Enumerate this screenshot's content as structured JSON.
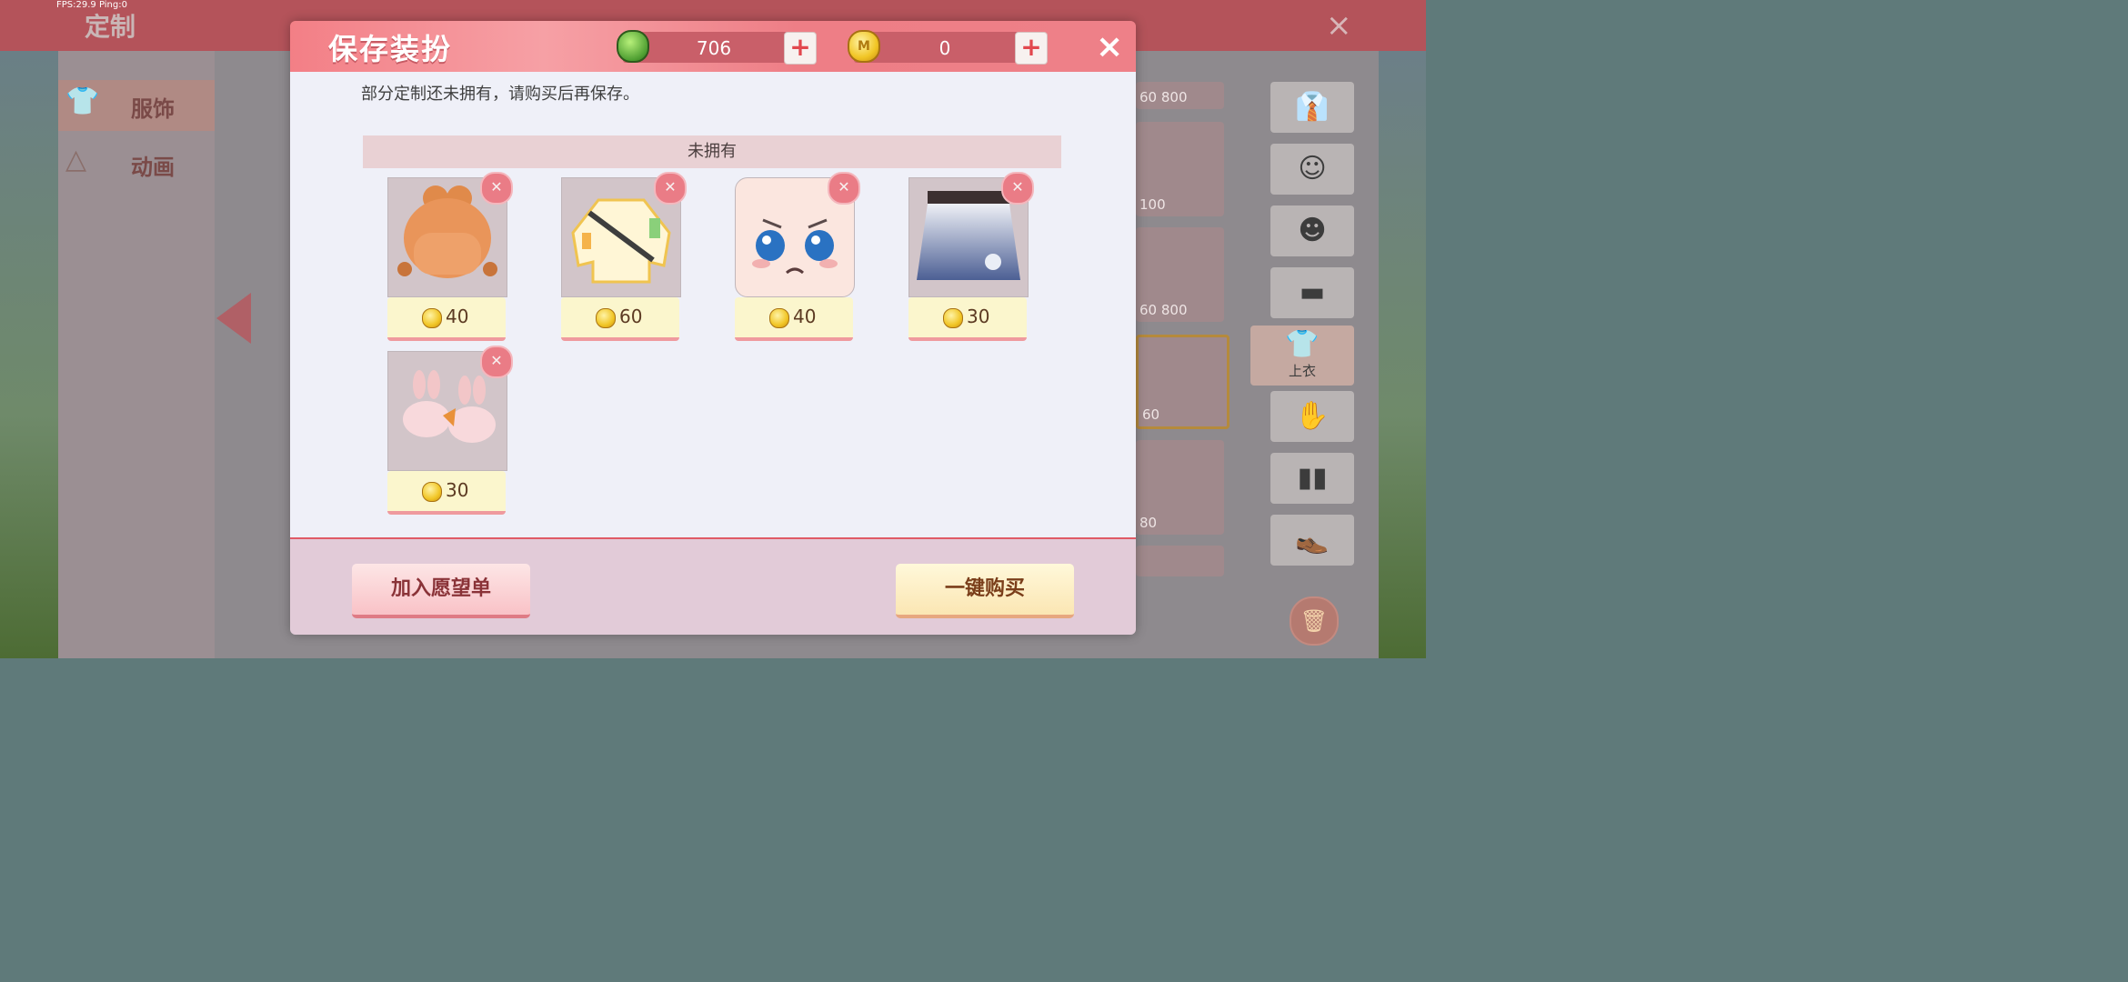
{
  "status": {
    "fps": "FPS:29.9  Ping:0"
  },
  "page": {
    "title": "定制",
    "close": "×"
  },
  "leftnav": {
    "items": [
      {
        "label": "服饰",
        "active": true
      },
      {
        "label": "动画",
        "active": false
      }
    ]
  },
  "right_cards": {
    "prices": [
      "60",
      "800",
      "100",
      "60",
      "800",
      "60",
      "80"
    ]
  },
  "right_tabs": {
    "selected_label": "上衣"
  },
  "dialog": {
    "title": "保存装扮",
    "currency": {
      "gem": "706",
      "coin": "0"
    },
    "plus": "+",
    "close": "×",
    "message": "部分定制还未拥有，请购买后再保存。",
    "section_title": "未拥有",
    "items": [
      {
        "name": "hair",
        "price": "40"
      },
      {
        "name": "jacket",
        "price": "60"
      },
      {
        "name": "face",
        "price": "40"
      },
      {
        "name": "skirt",
        "price": "30"
      },
      {
        "name": "slippers",
        "price": "30"
      }
    ],
    "wishlist_button": "加入愿望单",
    "buy_button": "一键购买"
  }
}
